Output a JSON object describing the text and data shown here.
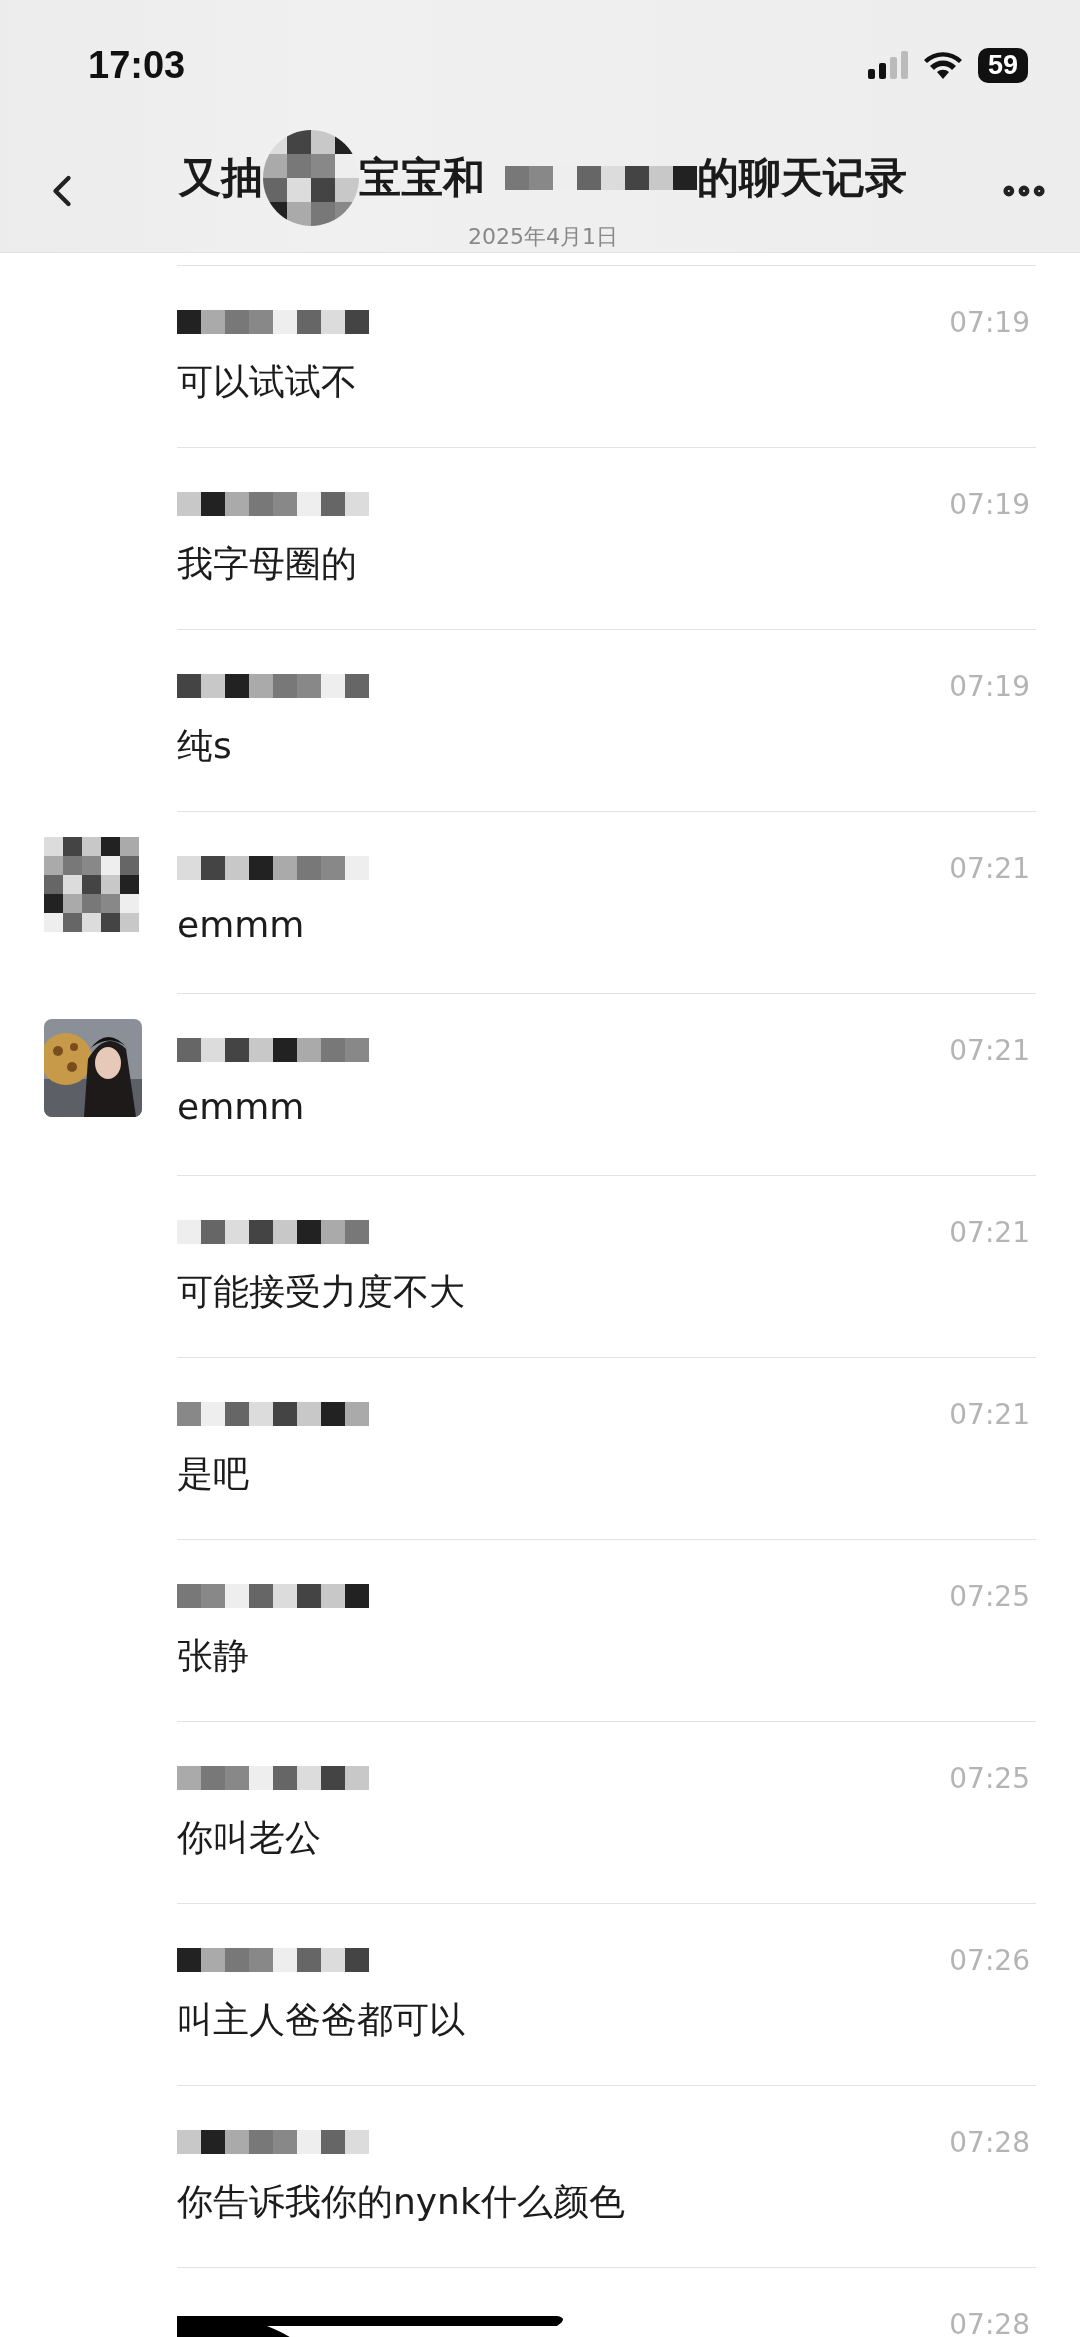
{
  "status_bar": {
    "time": "17:03",
    "battery": "59"
  },
  "header": {
    "title_parts": [
      "又抽",
      "宝宝和",
      "的聊天记录"
    ],
    "date": "2025年4月1日"
  },
  "messages": [
    {
      "kind": "plain",
      "time": "07:19",
      "text": "可以试试不"
    },
    {
      "kind": "plain",
      "time": "07:19",
      "text": "我字母圈的"
    },
    {
      "kind": "plain",
      "time": "07:19",
      "text": "纯s"
    },
    {
      "kind": "mosaic",
      "time": "07:21",
      "text": "emmm"
    },
    {
      "time": "07:21",
      "text": "emmm"
    },
    {
      "kind": "plain",
      "time": "07:21",
      "text": "可能接受力度不大"
    },
    {
      "kind": "plain",
      "time": "07:21",
      "text": "是吧"
    },
    {
      "kind": "plain",
      "time": "07:25",
      "text": "张静"
    },
    {
      "kind": "plain",
      "time": "07:25",
      "text": "你叫老公"
    },
    {
      "kind": "plain",
      "time": "07:26",
      "text": "叫主人爸爸都可以"
    },
    {
      "kind": "plain",
      "time": "07:28",
      "text": "你告诉我你的nynk什么颜色"
    },
    {
      "kind": "scribbled",
      "time": "07:28"
    }
  ]
}
